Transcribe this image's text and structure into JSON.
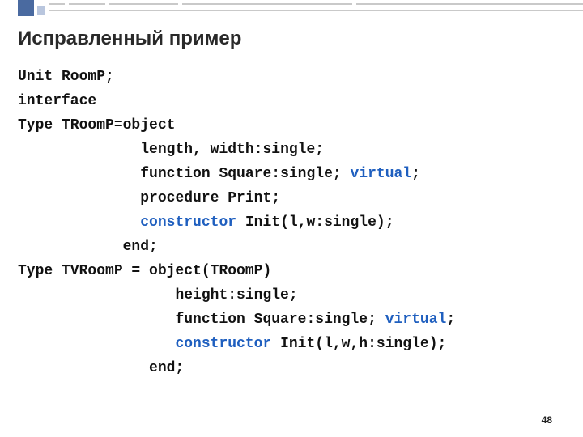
{
  "title": "Исправленный пример",
  "page_number": "48",
  "code": {
    "l1": "Unit RoomP;",
    "l2": "interface",
    "l3": "Type TRoomP=object",
    "l4_indent": "              ",
    "l4": "length, width:single;",
    "l5_indent": "              ",
    "l5a": "function Square:single; ",
    "l5_virtual": "virtual",
    "l5b": ";",
    "l6_indent": "              ",
    "l6": "procedure Print;",
    "l7_indent": "              ",
    "l7_ctor": "constructor",
    "l7b": " Init(l,w:single);",
    "l8_indent": "            ",
    "l8": "end;",
    "l9": "Type TVRoomP = object(TRoomP)",
    "l10_indent": "                  ",
    "l10": "height:single;",
    "l11_indent": "                  ",
    "l11a": "function Square:single; ",
    "l11_virtual": "virtual",
    "l11b": ";",
    "l12_indent": "                  ",
    "l12_ctor": "constructor",
    "l12b": " Init(l,w,h:single);",
    "l13_indent": "               ",
    "l13": "end;"
  }
}
